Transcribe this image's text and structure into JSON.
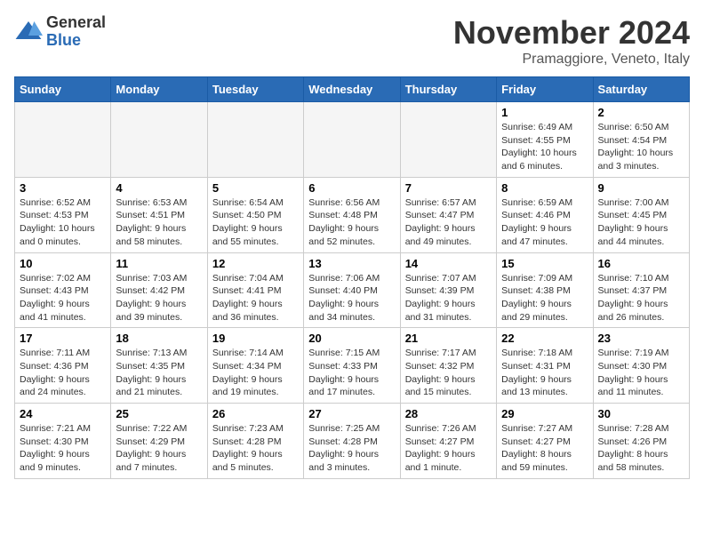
{
  "header": {
    "logo": {
      "general": "General",
      "blue": "Blue"
    },
    "title": "November 2024",
    "location": "Pramaggiore, Veneto, Italy"
  },
  "weekdays": [
    "Sunday",
    "Monday",
    "Tuesday",
    "Wednesday",
    "Thursday",
    "Friday",
    "Saturday"
  ],
  "weeks": [
    [
      {
        "day": "",
        "info": ""
      },
      {
        "day": "",
        "info": ""
      },
      {
        "day": "",
        "info": ""
      },
      {
        "day": "",
        "info": ""
      },
      {
        "day": "",
        "info": ""
      },
      {
        "day": "1",
        "info": "Sunrise: 6:49 AM\nSunset: 4:55 PM\nDaylight: 10 hours\nand 6 minutes."
      },
      {
        "day": "2",
        "info": "Sunrise: 6:50 AM\nSunset: 4:54 PM\nDaylight: 10 hours\nand 3 minutes."
      }
    ],
    [
      {
        "day": "3",
        "info": "Sunrise: 6:52 AM\nSunset: 4:53 PM\nDaylight: 10 hours\nand 0 minutes."
      },
      {
        "day": "4",
        "info": "Sunrise: 6:53 AM\nSunset: 4:51 PM\nDaylight: 9 hours\nand 58 minutes."
      },
      {
        "day": "5",
        "info": "Sunrise: 6:54 AM\nSunset: 4:50 PM\nDaylight: 9 hours\nand 55 minutes."
      },
      {
        "day": "6",
        "info": "Sunrise: 6:56 AM\nSunset: 4:48 PM\nDaylight: 9 hours\nand 52 minutes."
      },
      {
        "day": "7",
        "info": "Sunrise: 6:57 AM\nSunset: 4:47 PM\nDaylight: 9 hours\nand 49 minutes."
      },
      {
        "day": "8",
        "info": "Sunrise: 6:59 AM\nSunset: 4:46 PM\nDaylight: 9 hours\nand 47 minutes."
      },
      {
        "day": "9",
        "info": "Sunrise: 7:00 AM\nSunset: 4:45 PM\nDaylight: 9 hours\nand 44 minutes."
      }
    ],
    [
      {
        "day": "10",
        "info": "Sunrise: 7:02 AM\nSunset: 4:43 PM\nDaylight: 9 hours\nand 41 minutes."
      },
      {
        "day": "11",
        "info": "Sunrise: 7:03 AM\nSunset: 4:42 PM\nDaylight: 9 hours\nand 39 minutes."
      },
      {
        "day": "12",
        "info": "Sunrise: 7:04 AM\nSunset: 4:41 PM\nDaylight: 9 hours\nand 36 minutes."
      },
      {
        "day": "13",
        "info": "Sunrise: 7:06 AM\nSunset: 4:40 PM\nDaylight: 9 hours\nand 34 minutes."
      },
      {
        "day": "14",
        "info": "Sunrise: 7:07 AM\nSunset: 4:39 PM\nDaylight: 9 hours\nand 31 minutes."
      },
      {
        "day": "15",
        "info": "Sunrise: 7:09 AM\nSunset: 4:38 PM\nDaylight: 9 hours\nand 29 minutes."
      },
      {
        "day": "16",
        "info": "Sunrise: 7:10 AM\nSunset: 4:37 PM\nDaylight: 9 hours\nand 26 minutes."
      }
    ],
    [
      {
        "day": "17",
        "info": "Sunrise: 7:11 AM\nSunset: 4:36 PM\nDaylight: 9 hours\nand 24 minutes."
      },
      {
        "day": "18",
        "info": "Sunrise: 7:13 AM\nSunset: 4:35 PM\nDaylight: 9 hours\nand 21 minutes."
      },
      {
        "day": "19",
        "info": "Sunrise: 7:14 AM\nSunset: 4:34 PM\nDaylight: 9 hours\nand 19 minutes."
      },
      {
        "day": "20",
        "info": "Sunrise: 7:15 AM\nSunset: 4:33 PM\nDaylight: 9 hours\nand 17 minutes."
      },
      {
        "day": "21",
        "info": "Sunrise: 7:17 AM\nSunset: 4:32 PM\nDaylight: 9 hours\nand 15 minutes."
      },
      {
        "day": "22",
        "info": "Sunrise: 7:18 AM\nSunset: 4:31 PM\nDaylight: 9 hours\nand 13 minutes."
      },
      {
        "day": "23",
        "info": "Sunrise: 7:19 AM\nSunset: 4:30 PM\nDaylight: 9 hours\nand 11 minutes."
      }
    ],
    [
      {
        "day": "24",
        "info": "Sunrise: 7:21 AM\nSunset: 4:30 PM\nDaylight: 9 hours\nand 9 minutes."
      },
      {
        "day": "25",
        "info": "Sunrise: 7:22 AM\nSunset: 4:29 PM\nDaylight: 9 hours\nand 7 minutes."
      },
      {
        "day": "26",
        "info": "Sunrise: 7:23 AM\nSunset: 4:28 PM\nDaylight: 9 hours\nand 5 minutes."
      },
      {
        "day": "27",
        "info": "Sunrise: 7:25 AM\nSunset: 4:28 PM\nDaylight: 9 hours\nand 3 minutes."
      },
      {
        "day": "28",
        "info": "Sunrise: 7:26 AM\nSunset: 4:27 PM\nDaylight: 9 hours\nand 1 minute."
      },
      {
        "day": "29",
        "info": "Sunrise: 7:27 AM\nSunset: 4:27 PM\nDaylight: 8 hours\nand 59 minutes."
      },
      {
        "day": "30",
        "info": "Sunrise: 7:28 AM\nSunset: 4:26 PM\nDaylight: 8 hours\nand 58 minutes."
      }
    ]
  ]
}
